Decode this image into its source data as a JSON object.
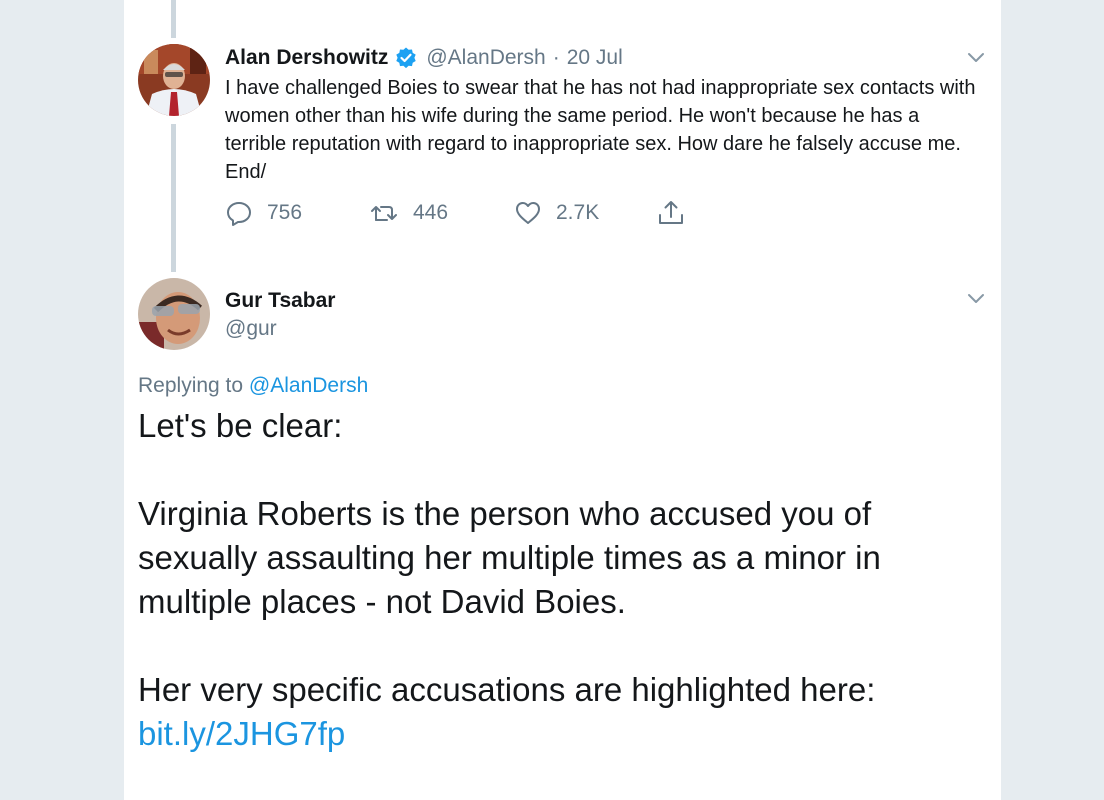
{
  "tweet1": {
    "name": "Alan Dershowitz",
    "verified": true,
    "handle": "@AlanDersh",
    "date_sep": "·",
    "date": "20 Jul",
    "text": "I have challenged Boies to swear that he has not had inappropriate sex contacts with women other than his wife during the same period. He won't because he has a terrible reputation with regard to inappropriate sex. How dare he falsely accuse me. End/",
    "actions": {
      "replies": "756",
      "retweets": "446",
      "likes": "2.7K"
    }
  },
  "tweet2": {
    "name": "Gur Tsabar",
    "handle": "@gur",
    "replying_prefix": "Replying to",
    "replying_to": "@AlanDersh",
    "intro": "Let's be clear:",
    "paragraph1": "Virginia Roberts is the person who accused you of sexually assaulting her multiple times as a minor in multiple places - not David Boies.",
    "paragraph2": "Her very specific accusations are highlighted here:",
    "link": "bit.ly/2JHG7fp"
  },
  "colors": {
    "link": "#1b95e0",
    "secondary": "#657786",
    "verified": "#1da1f2",
    "thread_line": "#ccd6dd"
  },
  "icons": [
    "verified-badge-icon",
    "chevron-down-icon",
    "reply-icon",
    "retweet-icon",
    "like-icon",
    "share-icon"
  ]
}
